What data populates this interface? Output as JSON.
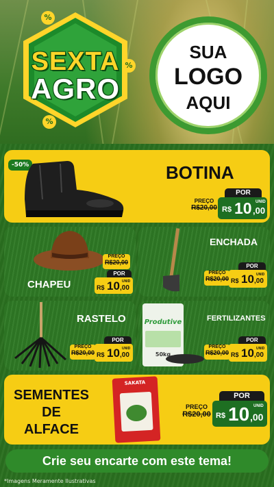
{
  "badge": {
    "line1": "SEXTA",
    "line2": "AGRO",
    "percent": "%"
  },
  "logo": {
    "line1": "SUA",
    "line2": "LOGO",
    "line3": "AQUI"
  },
  "common": {
    "por": "POR",
    "preco": "PREÇO",
    "old_price": "R$20,00",
    "currency": "R$",
    "price": "10,00",
    "unit": "UNID",
    "price_whole": "10",
    "price_cents": ",00"
  },
  "products": {
    "botina": {
      "name": "BOTINA",
      "discount": "-50%"
    },
    "chapeu": {
      "name": "CHAPEU"
    },
    "enchada": {
      "name": "ENCHADA"
    },
    "rastelo": {
      "name": "RASTELO"
    },
    "fertilizantes": {
      "name": "FERTILIZANTES",
      "bag_brand": "Produtive",
      "bag_weight": "50kg"
    },
    "sementes": {
      "name_lines": [
        "SEMENTES",
        "DE",
        "ALFACE"
      ],
      "pack_brand": "SAKATA"
    }
  },
  "footer": {
    "cta": "Crie seu encarte com este tema!",
    "note": "*Imagens Meramente Ilustrativas"
  },
  "colors": {
    "yellow": "#f6cd14",
    "green": "#1e6f22",
    "dark": "#1a1a1a"
  }
}
